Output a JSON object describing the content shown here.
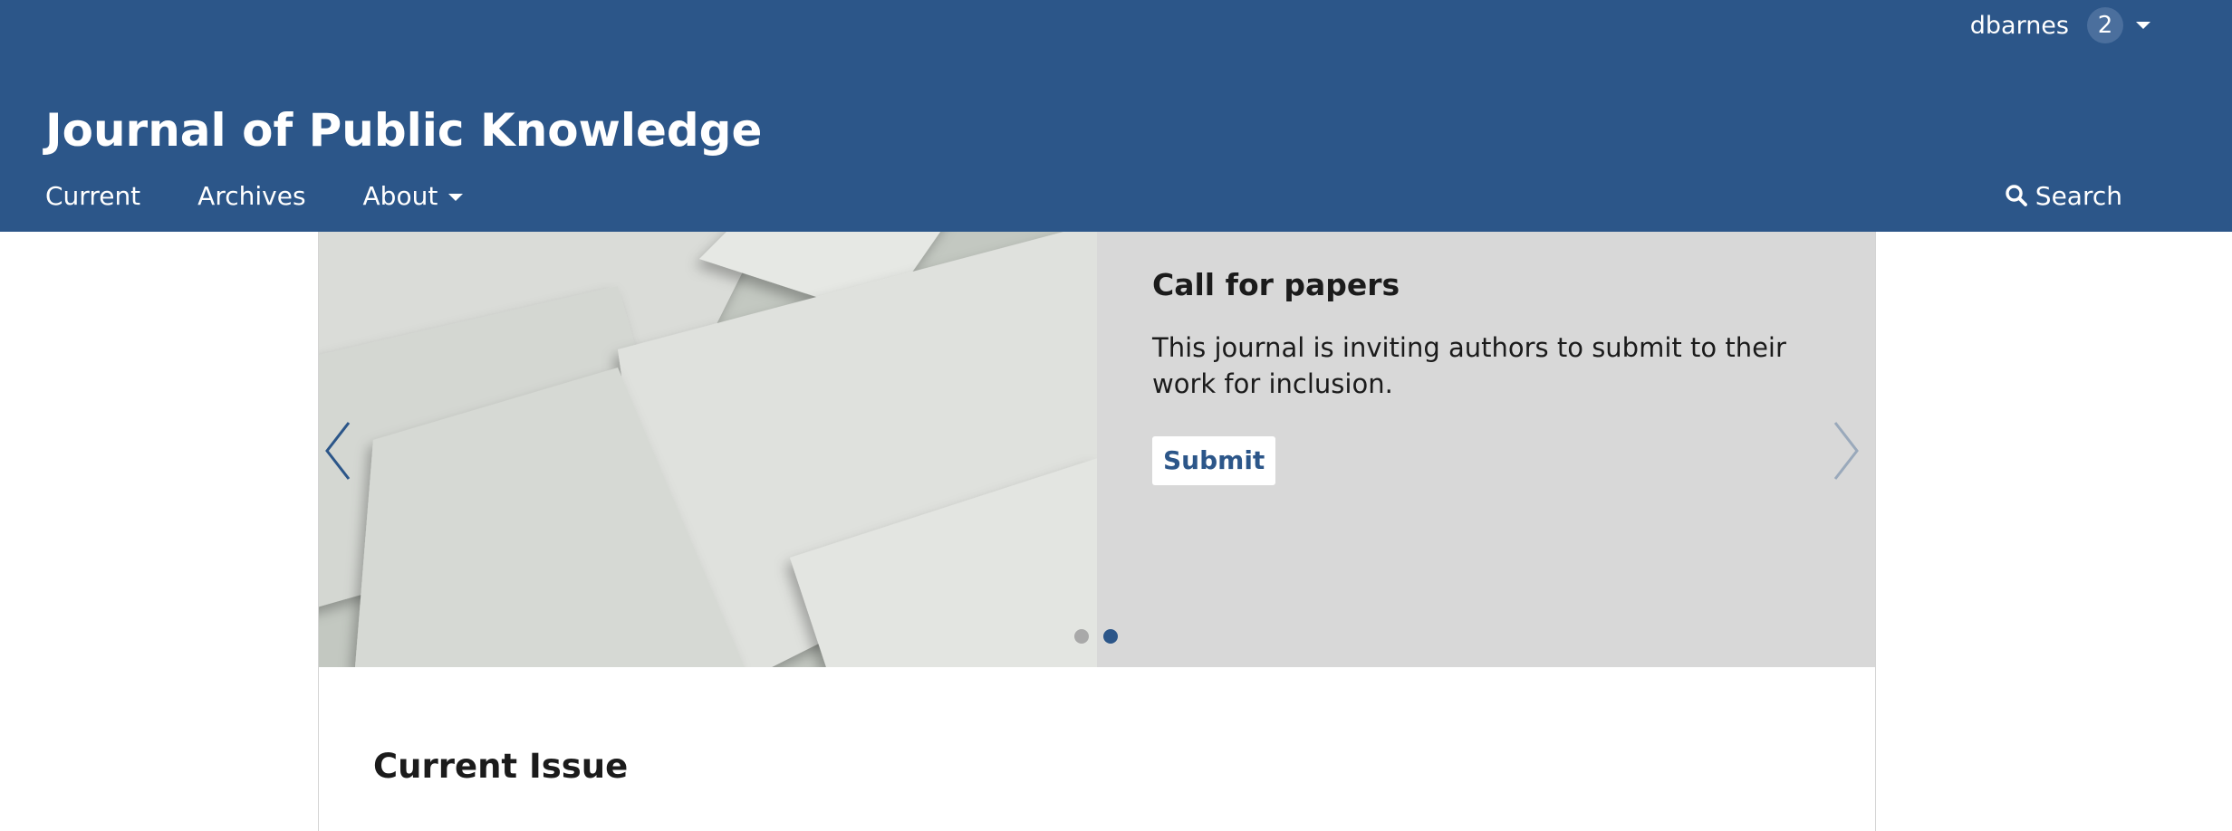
{
  "colors": {
    "header_bg": "#2c5689",
    "accent": "#2c5689",
    "carousel_bg": "#d8d8d8",
    "dot_inactive": "#a9a9a9",
    "dot_active": "#2c5689",
    "arrow_prev": "#2c5689",
    "arrow_next": "#9aa9bb"
  },
  "user_menu": {
    "username": "dbarnes",
    "notification_count": "2",
    "icon": "chevron-down-icon"
  },
  "site": {
    "title": "Journal of Public Knowledge"
  },
  "nav": {
    "items": [
      {
        "label": "Current"
      },
      {
        "label": "Archives"
      },
      {
        "label": "About",
        "icon": "chevron-down-icon"
      }
    ],
    "search_label": "Search",
    "search_icon": "search-icon"
  },
  "carousel": {
    "slide": {
      "heading": "Call for papers",
      "body": "This journal is inviting authors to submit to their work for inclusion.",
      "button_label": "Submit"
    },
    "prev_icon": "chevron-left-icon",
    "next_icon": "chevron-right-icon",
    "slide_count": 2,
    "active_slide": 2
  },
  "main": {
    "section_title": "Current Issue"
  }
}
